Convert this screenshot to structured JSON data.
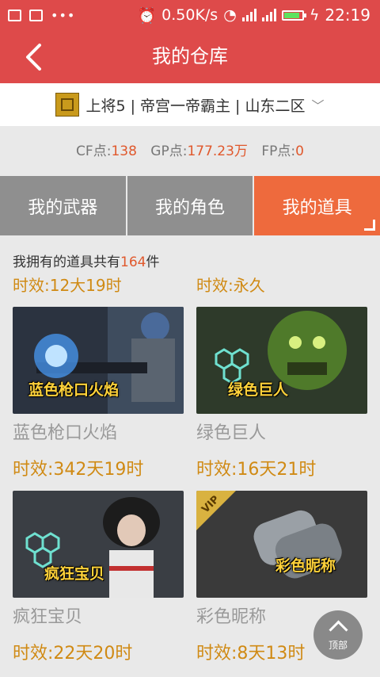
{
  "status_bar": {
    "speed": "0.50K/s",
    "time": "22:19"
  },
  "header": {
    "title": "我的仓库"
  },
  "account": {
    "text": "上将5 | 帝宫一帝霸主 | 山东二区"
  },
  "points": [
    {
      "label": "CF点:",
      "value": "138"
    },
    {
      "label": "GP点:",
      "value": "177.23万"
    },
    {
      "label": "FP点:",
      "value": "0"
    }
  ],
  "tabs": [
    "我的武器",
    "我的角色",
    "我的道具"
  ],
  "inventory": {
    "count_prefix": "我拥有的道具共有",
    "count": "164",
    "count_suffix": "件"
  },
  "top_row": [
    {
      "validity": "时效:12大19时"
    },
    {
      "validity": "时效:永久"
    }
  ],
  "items": [
    {
      "name": "蓝色枪口火焰",
      "thumb_label": "蓝色枪口火焰",
      "validity": "时效:342天19时"
    },
    {
      "name": "绿色巨人",
      "thumb_label": "绿色巨人",
      "validity": "时效:16天21时"
    },
    {
      "name": "疯狂宝贝",
      "thumb_label": "疯狂宝贝",
      "validity": "时效:22天20时"
    },
    {
      "name": "彩色昵称",
      "thumb_label": "彩色昵称",
      "badge": "VIP",
      "validity": "时效:8天13时"
    }
  ],
  "back_to_top": "顶部",
  "colors": {
    "brand_red": "#de4a4a",
    "active_tab": "#ee6a3d",
    "accent_orange": "#e0582c",
    "validity_text": "#d08a14"
  }
}
